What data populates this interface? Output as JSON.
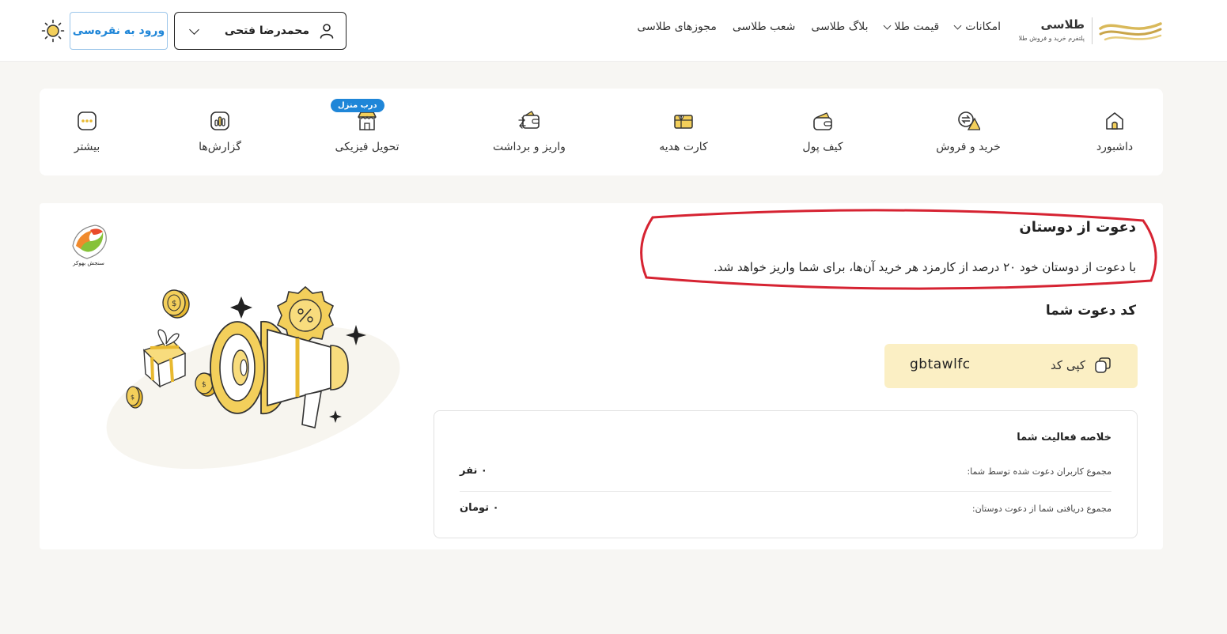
{
  "header": {
    "logo": {
      "name": "طلاسی",
      "tagline": "پلتفرم خرید و فروش طلا"
    },
    "nav": [
      {
        "label": "امکانات",
        "has_dropdown": true
      },
      {
        "label": "قیمت طلا",
        "has_dropdown": true
      },
      {
        "label": "بلاگ طلاسی",
        "has_dropdown": false
      },
      {
        "label": "شعب طلاسی",
        "has_dropdown": false
      },
      {
        "label": "مجوزهای طلاسی",
        "has_dropdown": false
      }
    ],
    "user": {
      "name": "محمدرضا فتحی"
    },
    "login_button": "ورود به نقره‌سی",
    "theme_icon": "sun-icon"
  },
  "menu": {
    "items": [
      {
        "label": "داشبورد",
        "icon": "home-icon"
      },
      {
        "label": "خرید و فروش",
        "icon": "exchange-icon"
      },
      {
        "label": "کیف پول",
        "icon": "wallet-icon"
      },
      {
        "label": "کارت هدیه",
        "icon": "gift-card-icon"
      },
      {
        "label": "واریز و برداشت",
        "icon": "deposit-withdraw-icon"
      },
      {
        "label": "تحویل فیزیکی",
        "icon": "store-icon",
        "badge": "درب منزل"
      },
      {
        "label": "گزارش‌ها",
        "icon": "reports-icon"
      },
      {
        "label": "بیشتر",
        "icon": "more-icon"
      }
    ]
  },
  "invite": {
    "title": "دعوت از دوستان",
    "description": "با دعوت از دوستان خود ۲۰ درصد از کارمزد هر خرید آن‌ها، برای شما واریز خواهد شد.",
    "code_title": "کد دعوت شما",
    "code": "gbtawlfc",
    "copy_label": "کپی کد"
  },
  "summary": {
    "title": "خلاصه فعالیت شما",
    "rows": [
      {
        "label": "مجموع کاربران دعوت شده توسط شما:",
        "value": "۰ نفر"
      },
      {
        "label": "مجموع دریافتی شما از دعوت دوستان:",
        "value": "۰ تومان"
      }
    ]
  },
  "watermark": {
    "text": "سنجش بهوکر"
  },
  "colors": {
    "accent_gold": "#f3cf5b",
    "code_background": "#fbefc4",
    "login_blue": "#1f86d8",
    "highlight_red": "#d62332",
    "page_background": "#f7f6f3"
  }
}
